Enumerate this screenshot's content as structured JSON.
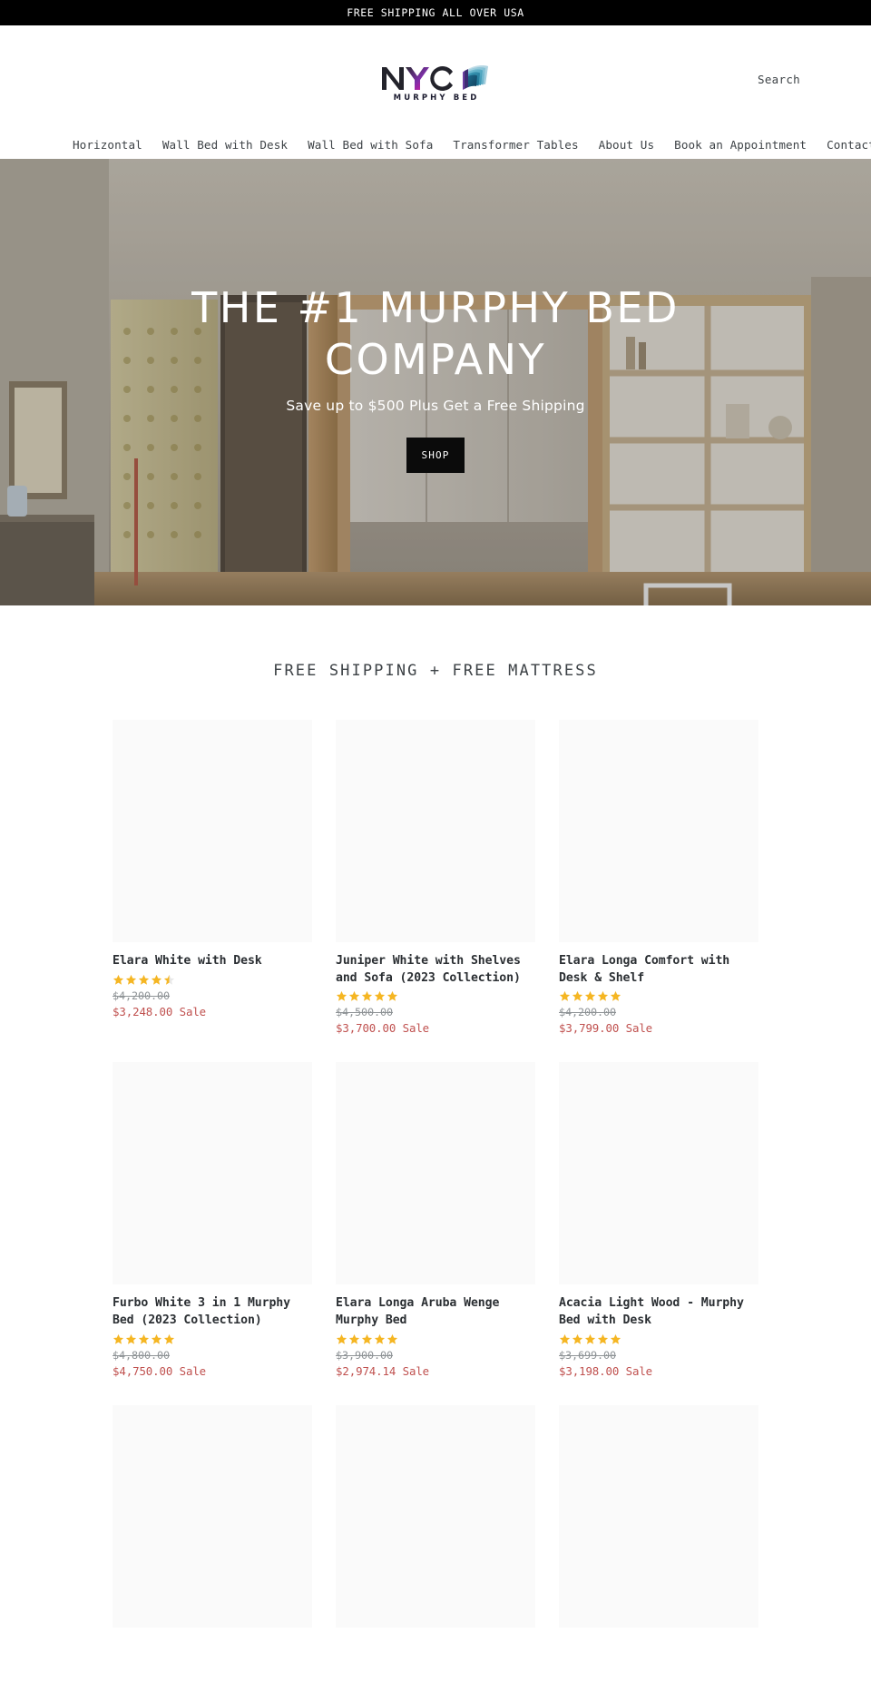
{
  "announcement": {
    "text": "FREE SHIPPING ALL OVER USA"
  },
  "header": {
    "logo": {
      "main": "NYC",
      "sub": "MURPHY BED",
      "icon": "book-fan-icon"
    },
    "search_label": "Search"
  },
  "nav": {
    "items": [
      {
        "label": "Horizontal"
      },
      {
        "label": "Wall Bed with Desk"
      },
      {
        "label": "Wall Bed with Sofa"
      },
      {
        "label": "Transformer Tables"
      },
      {
        "label": "About Us"
      },
      {
        "label": "Book an Appointment"
      },
      {
        "label": "Contact"
      }
    ]
  },
  "hero": {
    "title": "THE #1 MURPHY BED COMPANY",
    "subtitle": "Save up to $500 Plus Get a Free Shipping",
    "button_label": "SHOP"
  },
  "collection": {
    "title": "FREE SHIPPING + FREE MATTRESS",
    "sale_tag": "Sale",
    "star_color": "#f5b623",
    "sale_price_color": "#c0514f",
    "products": [
      {
        "title": "Elara White with Desk",
        "rating": 4.5,
        "price_was": "$4,200.00",
        "price_now": "$3,248.00 Sale"
      },
      {
        "title": "Juniper White with Shelves and Sofa (2023 Collection)",
        "rating": 5,
        "price_was": "$4,500.00",
        "price_now": "$3,700.00 Sale"
      },
      {
        "title": "Elara Longa Comfort with Desk & Shelf",
        "rating": 5,
        "price_was": "$4,200.00",
        "price_now": "$3,799.00 Sale"
      },
      {
        "title": "Furbo White 3 in 1 Murphy Bed (2023 Collection)",
        "rating": 5,
        "price_was": "$4,800.00",
        "price_now": "$4,750.00 Sale"
      },
      {
        "title": "Elara Longa Aruba Wenge Murphy Bed",
        "rating": 5,
        "price_was": "$3,900.00",
        "price_now": "$2,974.14 Sale"
      },
      {
        "title": "Acacia Light Wood - Murphy Bed with Desk",
        "rating": 5,
        "price_was": "$3,699.00",
        "price_now": "$3,198.00 Sale"
      },
      {
        "title": "",
        "rating": 0,
        "price_was": "",
        "price_now": ""
      },
      {
        "title": "",
        "rating": 0,
        "price_was": "",
        "price_now": ""
      },
      {
        "title": "",
        "rating": 0,
        "price_was": "",
        "price_now": ""
      }
    ]
  }
}
